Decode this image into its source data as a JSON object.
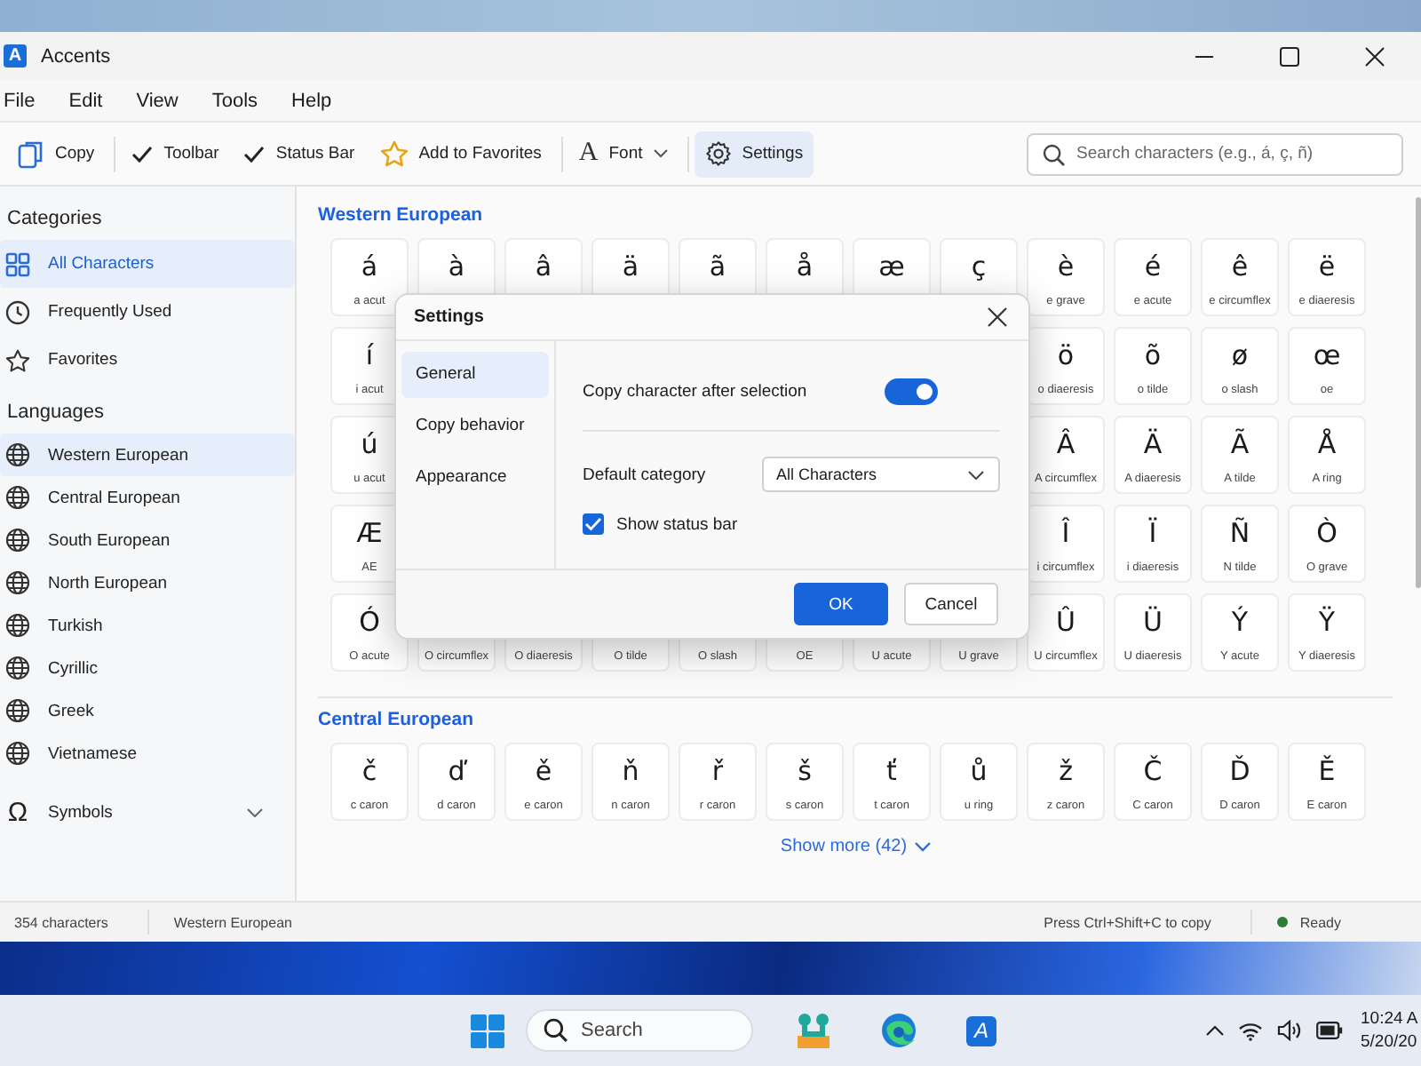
{
  "window": {
    "title": "Accents",
    "app_glyph": "A"
  },
  "menu": [
    "File",
    "Edit",
    "View",
    "Tools",
    "Help"
  ],
  "toolbar": [
    {
      "kind": "copy",
      "label": "Copy",
      "divider_before": false
    },
    {
      "kind": "toggle",
      "label": "Toolbar",
      "checked": true,
      "divider_before": true
    },
    {
      "kind": "toggle",
      "label": "Status Bar",
      "checked": true,
      "divider_before": false
    },
    {
      "kind": "favorite",
      "label": "Add to Favorites",
      "divider_before": false
    },
    {
      "kind": "font",
      "glyph": "A",
      "label": "Font",
      "divider_before": true
    },
    {
      "kind": "settings",
      "label": "Settings",
      "selected": true,
      "divider_before": true
    }
  ],
  "search": {
    "placeholder": "Search characters (e.g., á, ç, ñ)"
  },
  "sidebar": {
    "sections": [
      {
        "title": "Categories",
        "items": [
          {
            "kind": "grid",
            "label": "All Characters",
            "selected": true
          },
          {
            "kind": "clock",
            "label": "Frequently Used",
            "selected": false
          },
          {
            "kind": "star",
            "label": "Favorites",
            "selected": false
          }
        ]
      },
      {
        "title": "Languages",
        "items": [
          {
            "kind": "globe",
            "label": "Western European",
            "selected": true
          },
          {
            "kind": "globe",
            "label": "Central European",
            "selected": false
          },
          {
            "kind": "globe",
            "label": "South European",
            "selected": false
          },
          {
            "kind": "globe",
            "label": "North European",
            "selected": false
          },
          {
            "kind": "globe",
            "label": "Turkish",
            "selected": false
          },
          {
            "kind": "globe",
            "label": "Cyrillic",
            "selected": false
          },
          {
            "kind": "globe",
            "label": "Greek",
            "selected": false
          },
          {
            "kind": "globe",
            "label": "Vietnamese",
            "selected": false
          }
        ]
      }
    ],
    "symbols": {
      "glyph": "Ω",
      "label": "Symbols",
      "expanded": false
    }
  },
  "groups": [
    {
      "title": "Western European",
      "cells": [
        {
          "char": "á",
          "name": "a acut"
        },
        {
          "char": "à"
        },
        {
          "char": "â"
        },
        {
          "char": "ä"
        },
        {
          "char": "ã"
        },
        {
          "char": "å"
        },
        {
          "char": "æ"
        },
        {
          "char": "ç"
        },
        {
          "char": "è",
          "name": "e grave"
        },
        {
          "char": "é",
          "name": "e acute"
        },
        {
          "char": "ê",
          "name": "e circumflex"
        },
        {
          "char": "ë",
          "name": "e diaeresis"
        },
        {
          "char": "í",
          "name": "i acut"
        },
        null,
        null,
        null,
        null,
        null,
        null,
        null,
        {
          "char": "ö",
          "name": "o diaeresis"
        },
        {
          "char": "õ",
          "name": "o tilde"
        },
        {
          "char": "ø",
          "name": "o slash"
        },
        {
          "char": "œ",
          "name": "oe"
        },
        {
          "char": "ú",
          "name": "u acut"
        },
        null,
        null,
        null,
        null,
        null,
        null,
        null,
        {
          "char": "Â",
          "name": "A circumflex"
        },
        {
          "char": "Ä",
          "name": "A diaeresis"
        },
        {
          "char": "Ã",
          "name": "A tilde"
        },
        {
          "char": "Å",
          "name": "A ring"
        },
        {
          "char": "Æ",
          "name": "AE"
        },
        null,
        null,
        null,
        null,
        null,
        null,
        null,
        {
          "char": "Î",
          "name": "i circumflex"
        },
        {
          "char": "Ï",
          "name": "i diaeresis"
        },
        {
          "char": "Ñ",
          "name": "N tilde"
        },
        {
          "char": "Ò",
          "name": "O grave"
        },
        {
          "char": "Ó",
          "name": "O acute"
        },
        {
          "name": "O circumflex"
        },
        {
          "name": "O diaeresis"
        },
        {
          "name": "O tilde"
        },
        {
          "name": "O slash"
        },
        {
          "name": "OE"
        },
        {
          "name": "U acute"
        },
        {
          "name": "U grave"
        },
        {
          "char": "Û",
          "name": "U circumflex"
        },
        {
          "char": "Ü",
          "name": "U diaeresis"
        },
        {
          "char": "Ý",
          "name": "Y acute"
        },
        {
          "char": "Ÿ",
          "name": "Y diaeresis"
        }
      ]
    },
    {
      "title": "Central European",
      "cells": [
        {
          "char": "č",
          "name": "c caron"
        },
        {
          "char": "ď",
          "name": "d caron"
        },
        {
          "char": "ě",
          "name": "e caron"
        },
        {
          "char": "ň",
          "name": "n caron"
        },
        {
          "char": "ř",
          "name": "r caron"
        },
        {
          "char": "š",
          "name": "s caron"
        },
        {
          "char": "ť",
          "name": "t caron"
        },
        {
          "char": "ů",
          "name": "u ring"
        },
        {
          "char": "ž",
          "name": "z caron"
        },
        {
          "char": "Č",
          "name": "C caron"
        },
        {
          "char": "Ď",
          "name": "D caron"
        },
        {
          "char": "Ě",
          "name": "E caron"
        }
      ],
      "show_more": "Show more (42)"
    }
  ],
  "status_bar": {
    "count": "354 characters",
    "section": "Western European",
    "hint": "Press Ctrl+Shift+C to copy",
    "state": "Ready"
  },
  "dialog": {
    "title": "Settings",
    "nav": [
      {
        "label": "General",
        "selected": true
      },
      {
        "label": "Copy behavior",
        "selected": false
      },
      {
        "label": "Appearance",
        "selected": false
      }
    ],
    "settings": [
      {
        "kind": "toggle",
        "label": "Copy character after selection",
        "on": true
      },
      {
        "kind": "select",
        "label": "Default category",
        "value": "All Characters"
      },
      {
        "kind": "checkbox",
        "label": "Show status bar",
        "checked": true
      }
    ],
    "buttons": [
      {
        "label": "OK",
        "primary": true
      },
      {
        "label": "Cancel",
        "primary": false
      }
    ]
  },
  "taskbar": {
    "search": {
      "placeholder": "Search"
    },
    "apps": [
      {
        "kind": "puzzle"
      },
      {
        "kind": "browser"
      },
      {
        "kind": "letter",
        "glyph": "A"
      }
    ],
    "time": "10:24 A",
    "date": "5/20/20"
  }
}
